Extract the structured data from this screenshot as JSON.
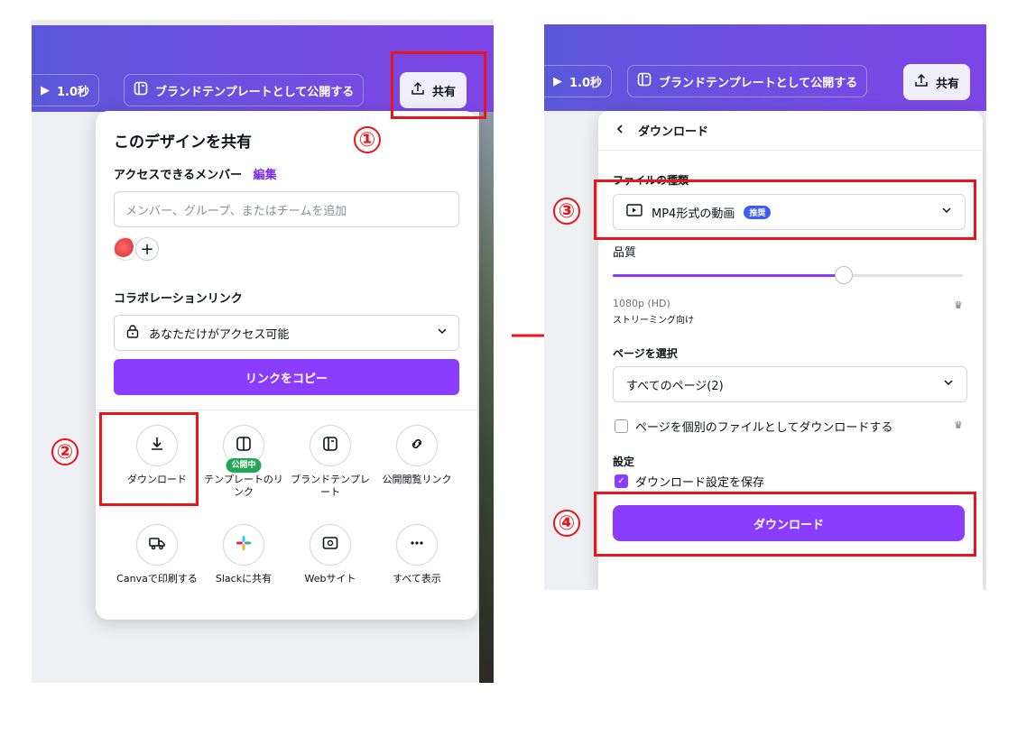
{
  "left": {
    "toolbar": {
      "timing": "1.0秒",
      "publish_label": "ブランドテンプレートとして公開する",
      "share_label": "共有"
    },
    "share_panel": {
      "title": "このデザインを共有",
      "members_label": "アクセスできるメンバー",
      "edit_link": "編集",
      "invite_placeholder": "メンバー、グループ、またはチームを追加",
      "add_symbol": "+",
      "collab_title": "コラボレーションリンク",
      "access_value": "あなただけがアクセス可能",
      "copy_button": "リンクをコピー",
      "options": [
        {
          "label": "ダウンロード",
          "icon": "download-icon"
        },
        {
          "label": "テンプレートのリンク",
          "icon": "template-icon",
          "badge": "公開中"
        },
        {
          "label": "ブランドテンプレート",
          "icon": "brand-template-icon"
        },
        {
          "label": "公開閲覧リンク",
          "icon": "link-icon"
        },
        {
          "label": "Canvaで印刷する",
          "icon": "truck-icon"
        },
        {
          "label": "Slackに共有",
          "icon": "slack-icon"
        },
        {
          "label": "Webサイト",
          "icon": "website-icon"
        },
        {
          "label": "すべて表示",
          "icon": "more-icon"
        }
      ]
    }
  },
  "right": {
    "toolbar": {
      "timing": "1.0秒",
      "publish_label": "ブランドテンプレートとして公開する",
      "share_label": "共有"
    },
    "download_panel": {
      "back_title": "ダウンロード",
      "file_type_label": "ファイルの種類",
      "file_type_value": "MP4形式の動画",
      "recommended_badge": "推奨",
      "quality_label": "品質",
      "quality_value": "1080p (HD)",
      "quality_sub": "ストリーミング向け",
      "quality_level": 0.66,
      "pages_label": "ページを選択",
      "pages_value": "すべてのページ(2)",
      "separate_files_label": "ページを個別のファイルとしてダウンロードする",
      "separate_files_checked": false,
      "settings_label": "設定",
      "save_settings_label": "ダウンロード設定を保存",
      "save_settings_checked": true,
      "download_button": "ダウンロード"
    }
  },
  "annotations": {
    "step1": "①",
    "step2": "②",
    "step3": "③",
    "step4": "④"
  },
  "colors": {
    "accent": "#8b3dff",
    "annotation_red": "#e8151b",
    "header_gradient_start": "#5a57d8",
    "header_gradient_end": "#7d45e6"
  }
}
